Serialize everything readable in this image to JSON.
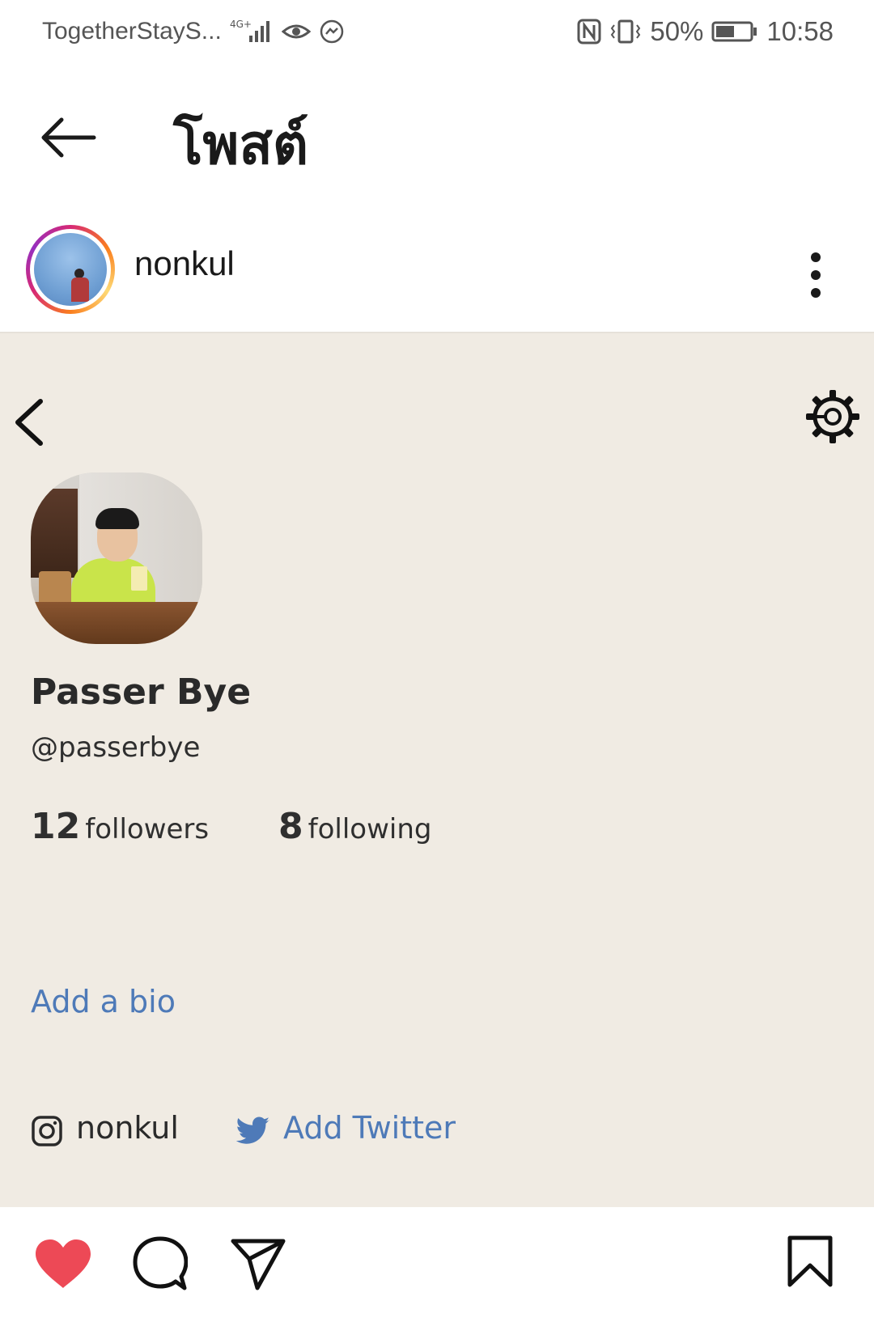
{
  "status_bar": {
    "carrier": "TogetherStayS...",
    "network": "4G+",
    "battery": "50%",
    "time": "10:58"
  },
  "header": {
    "title": "โพสต์"
  },
  "post_owner": {
    "username": "nonkul"
  },
  "profile_card": {
    "display_name": "Passer Bye",
    "handle": "@passerbye",
    "followers_count": "12",
    "followers_label": "followers",
    "following_count": "8",
    "following_label": "following",
    "add_bio": "Add a bio",
    "instagram_name": "nonkul",
    "add_twitter": "Add Twitter"
  },
  "colors": {
    "card_background": "#f0ebe3",
    "link_blue": "#4e7ab8",
    "heart_red": "#ed4956"
  },
  "icons": {
    "back": "back-arrow-icon",
    "more": "more-vertical-icon",
    "chevron": "chevron-left-icon",
    "settings": "gear-icon",
    "instagram": "instagram-icon",
    "twitter": "twitter-icon",
    "like": "heart-icon",
    "comment": "comment-icon",
    "share": "send-icon",
    "save": "bookmark-icon"
  }
}
